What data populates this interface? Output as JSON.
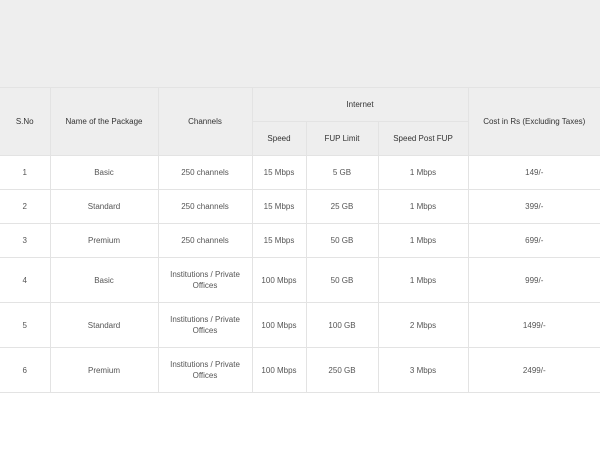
{
  "table": {
    "headers": {
      "sno": "S.No",
      "package_name": "Name of  the Package",
      "channels": "Channels",
      "internet": "Internet",
      "cost": "Cost in Rs (Excluding Taxes)"
    },
    "internet_subheaders": [
      "Speed",
      "FUP Limit",
      "Speed Post FUP"
    ],
    "rows": [
      {
        "sno": "1",
        "name": "Basic",
        "channels": "250 channels",
        "speed": "15 Mbps",
        "fup": "5 GB",
        "post_fup": "1 Mbps",
        "cost": "149/-"
      },
      {
        "sno": "2",
        "name": "Standard",
        "channels": "250 channels",
        "speed": "15 Mbps",
        "fup": "25 GB",
        "post_fup": "1 Mbps",
        "cost": "399/-"
      },
      {
        "sno": "3",
        "name": "Premium",
        "channels": "250 channels",
        "speed": "15 Mbps",
        "fup": "50 GB",
        "post_fup": "1 Mbps",
        "cost": "699/-"
      },
      {
        "sno": "4",
        "name": "Basic",
        "channels": "Institutions / Private Offices",
        "speed": "100 Mbps",
        "fup": "50 GB",
        "post_fup": "1 Mbps",
        "cost": "999/-"
      },
      {
        "sno": "5",
        "name": "Standard",
        "channels": "Institutions / Private Offices",
        "speed": "100 Mbps",
        "fup": "100 GB",
        "post_fup": "2 Mbps",
        "cost": "1499/-"
      },
      {
        "sno": "6",
        "name": "Premium",
        "channels": "Institutions / Private Offices",
        "speed": "100 Mbps",
        "fup": "250 GB",
        "post_fup": "3 Mbps",
        "cost": "2499/-"
      }
    ]
  }
}
